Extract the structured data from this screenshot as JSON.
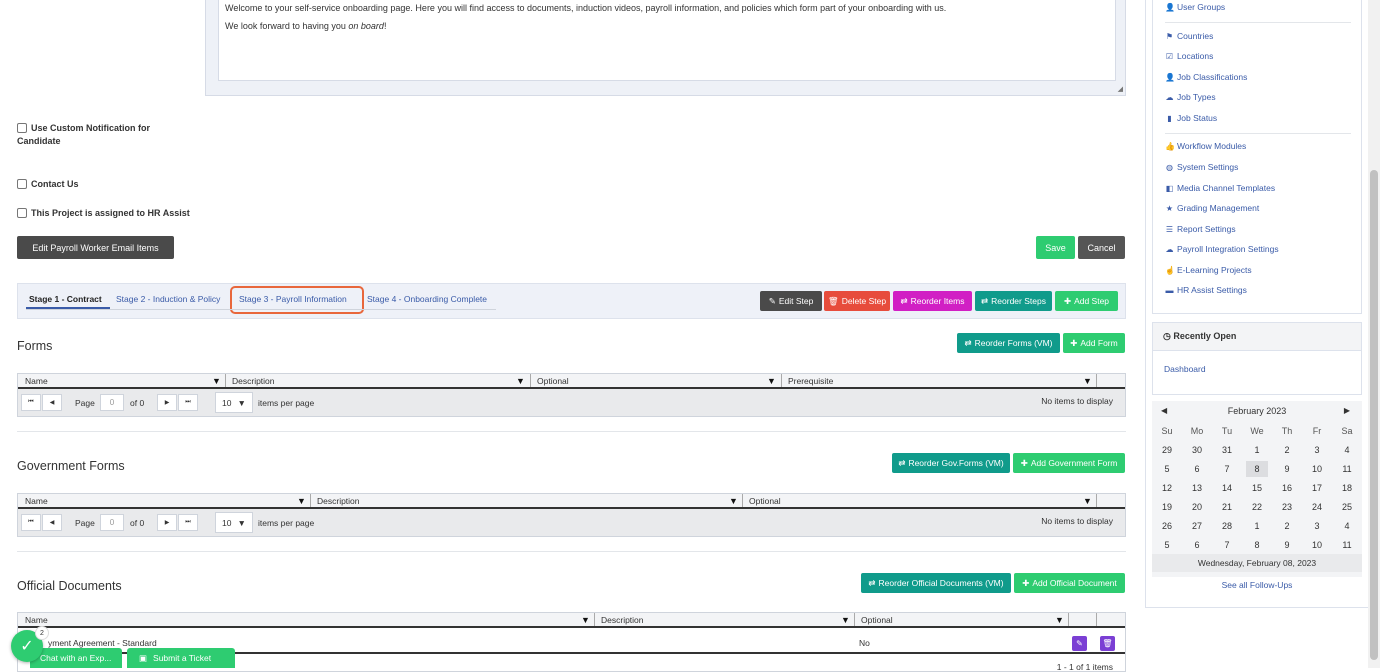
{
  "editor": {
    "line1": "Welcome to your self-service onboarding page. Here you will find access to documents, induction videos, payroll information, and policies which form part of your onboarding with us.",
    "line2_prefix": "We look forward to having you ",
    "line2_italic": "on board",
    "line2_suffix": "!"
  },
  "checkboxes": {
    "custom_notification_line1": "Use Custom Notification for",
    "custom_notification_line2": "Candidate",
    "contact_us": "Contact Us",
    "hr_assist": "This Project is assigned to HR Assist"
  },
  "buttons": {
    "edit_payroll": "Edit Payroll Worker Email Items",
    "save": "Save",
    "cancel": "Cancel"
  },
  "stages": {
    "tabs": [
      "Stage 1 - Contract",
      "Stage 2 - Induction & Policy",
      "Stage 3 - Payroll Information",
      "Stage 4 - Onboarding Complete"
    ],
    "edit_step": "Edit Step",
    "delete_step": "Delete Step",
    "reorder_items": "Reorder Items",
    "reorder_steps": "Reorder Steps",
    "add_step": "Add Step"
  },
  "forms": {
    "title": "Forms",
    "reorder": "Reorder Forms (VM)",
    "add": "Add Form",
    "columns": [
      "Name",
      "Description",
      "Optional",
      "Prerequisite"
    ]
  },
  "gov_forms": {
    "title": "Government Forms",
    "reorder": "Reorder Gov.Forms (VM)",
    "add": "Add Government Form",
    "columns": [
      "Name",
      "Description",
      "Optional"
    ]
  },
  "official_docs": {
    "title": "Official Documents",
    "reorder": "Reorder Official Documents (VM)",
    "add": "Add Official Document",
    "columns": [
      "Name",
      "Description",
      "Optional"
    ],
    "row_name": "yment Agreement - Standard",
    "row_optional": "No",
    "footer_count": "1 - 1 of 1 items"
  },
  "pager": {
    "page_label": "Page",
    "page_value": "0",
    "of_label": "of 0",
    "per_page": "10",
    "per_page_label": "items per page",
    "empty": "No items to display"
  },
  "sidebar": {
    "links": [
      {
        "icon": "user-icon",
        "label": "User Groups"
      },
      {
        "icon": "flag-icon",
        "label": "Countries"
      },
      {
        "icon": "check-square-icon",
        "label": "Locations"
      },
      {
        "icon": "user-icon",
        "label": "Job Classifications"
      },
      {
        "icon": "cloud-icon",
        "label": "Job Types"
      },
      {
        "icon": "book-icon",
        "label": "Job Status"
      },
      {
        "icon": "thumbs-up-icon",
        "label": "Workflow Modules"
      },
      {
        "icon": "globe-icon",
        "label": "System Settings"
      },
      {
        "icon": "media-icon",
        "label": "Media Channel Templates"
      },
      {
        "icon": "star-icon",
        "label": "Grading Management"
      },
      {
        "icon": "list-icon",
        "label": "Report Settings"
      },
      {
        "icon": "cloud-icon",
        "label": "Payroll Integration Settings"
      },
      {
        "icon": "hand-icon",
        "label": "E-Learning Projects"
      },
      {
        "icon": "suitcase-icon",
        "label": "HR Assist Settings"
      }
    ]
  },
  "recently_open": {
    "title": "Recently Open",
    "item": "Dashboard"
  },
  "calendar": {
    "month": "February 2023",
    "days": [
      "Su",
      "Mo",
      "Tu",
      "We",
      "Th",
      "Fr",
      "Sa"
    ],
    "weeks": [
      [
        "29",
        "30",
        "31",
        "1",
        "2",
        "3",
        "4"
      ],
      [
        "5",
        "6",
        "7",
        "8",
        "9",
        "10",
        "11"
      ],
      [
        "12",
        "13",
        "14",
        "15",
        "16",
        "17",
        "18"
      ],
      [
        "19",
        "20",
        "21",
        "22",
        "23",
        "24",
        "25"
      ],
      [
        "26",
        "27",
        "28",
        "1",
        "2",
        "3",
        "4"
      ],
      [
        "5",
        "6",
        "7",
        "8",
        "9",
        "10",
        "11"
      ]
    ],
    "today": "8",
    "footer": "Wednesday, February 08, 2023",
    "follow_ups": "See all Follow-Ups"
  },
  "chat": {
    "badge": "2",
    "chat_label": "Chat with an Exp...",
    "ticket_label": "Submit a Ticket"
  },
  "colors": {
    "accent_green": "#2ecc71",
    "teal": "#109b8b",
    "highlight": "#e8673c"
  }
}
